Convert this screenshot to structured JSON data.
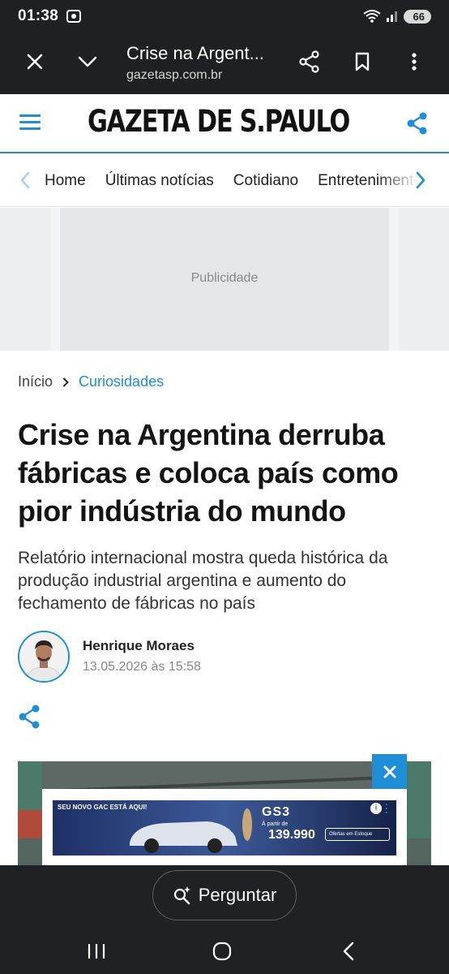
{
  "status_bar": {
    "time": "01:38",
    "battery": "66"
  },
  "browser": {
    "title": "Crise na Argent...",
    "url": "gazetasp.com.br"
  },
  "site": {
    "logo": "GAZETA DE S.PAULO"
  },
  "nav": {
    "items": [
      "Home",
      "Últimas notícias",
      "Cotidiano",
      "Entretenimento"
    ]
  },
  "ad": {
    "label": "Publicidade"
  },
  "breadcrumb": {
    "home": "Início",
    "category": "Curiosidades"
  },
  "article": {
    "headline": "Crise na Argentina derruba fábricas e coloca país como pior indústria do mundo",
    "subheadline": "Relatório internacional mostra queda histórica da produção industrial argentina e aumento do fechamento de fábricas no país",
    "author": "Henrique Moraes",
    "date": "13.05.2026 às 15:58"
  },
  "banner_ad": {
    "headline": "SEU NOVO GAC ESTÁ AQUI!",
    "model": "GS3",
    "price_prefix": "À partir de",
    "price": "139.990",
    "cta": "Ofertas em Estoque"
  },
  "ask": {
    "label": "Perguntar"
  },
  "colors": {
    "accent": "#1e8fd6",
    "chrome": "#1f2023"
  }
}
